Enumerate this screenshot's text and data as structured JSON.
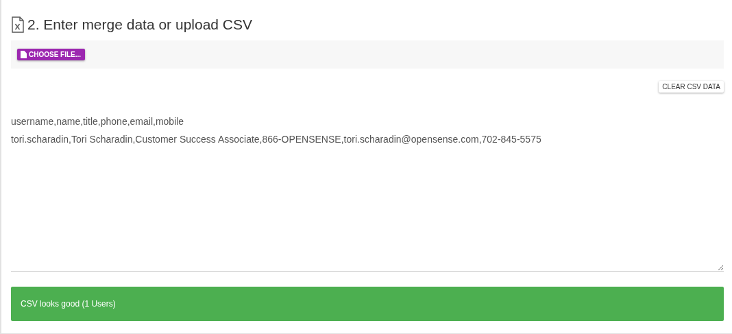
{
  "section": {
    "title": "2. Enter merge data or upload CSV"
  },
  "file_button": {
    "label": "CHOOSE FILE..."
  },
  "clear_button": {
    "label": "CLEAR CSV DATA"
  },
  "csv_data": {
    "lines": [
      "username,name,title,phone,email,mobile",
      "tori.scharadin,Tori Scharadin,Customer Success Associate,866-OPENSENSE,tori.scharadin@opensense.com,702-845-5575"
    ]
  },
  "alert": {
    "valid": true,
    "message": "CSV looks good (1 Users)"
  }
}
